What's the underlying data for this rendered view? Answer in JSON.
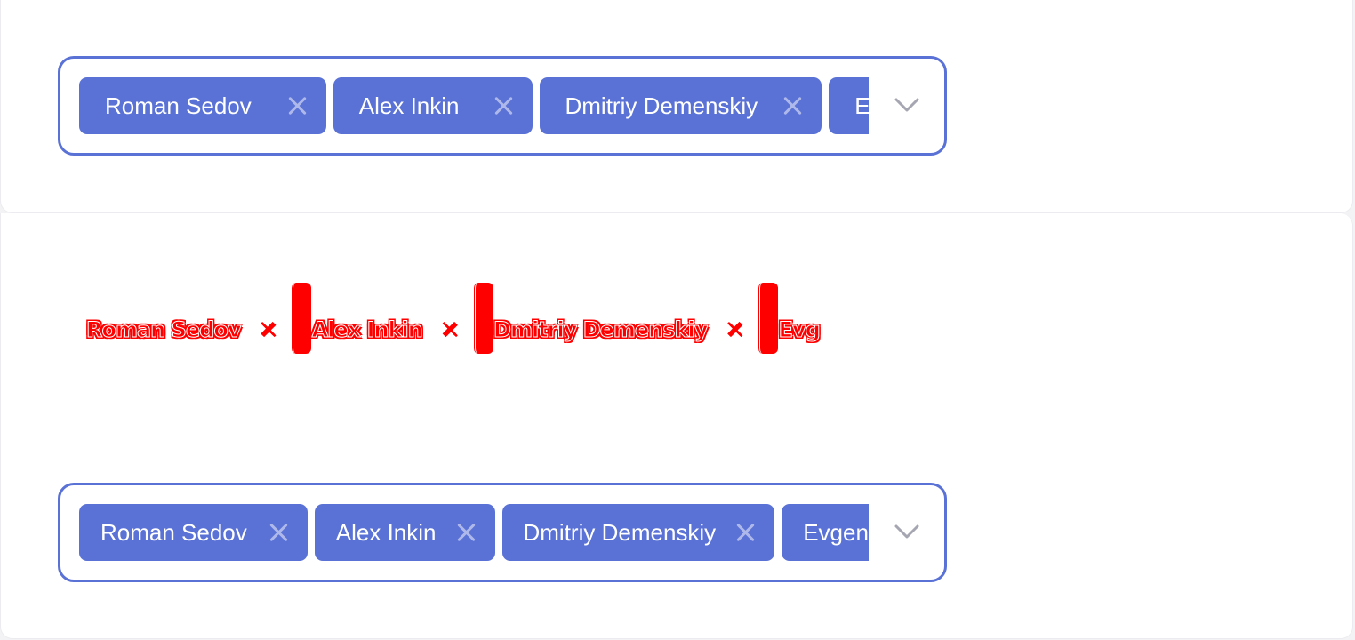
{
  "widgets": {
    "top": {
      "chips": [
        {
          "label": "Roman Sedov"
        },
        {
          "label": "Alex Inkin"
        },
        {
          "label": "Dmitriy Demenskiy"
        },
        {
          "label": "Evgeniy"
        }
      ]
    },
    "glitch": {
      "chips": [
        {
          "label": "Roman Sedov"
        },
        {
          "label": "Alex Inkin"
        },
        {
          "label": "Dmitriy Demenskiy"
        },
        {
          "label": "Evg"
        }
      ]
    },
    "bottom": {
      "chips": [
        {
          "label": "Roman Sedov"
        },
        {
          "label": "Alex Inkin"
        },
        {
          "label": "Dmitriy Demenskiy"
        },
        {
          "label": "Evgeniy"
        }
      ]
    }
  },
  "icons": {
    "chip_remove": "close-icon",
    "dropdown": "chevron-down-icon"
  },
  "colors": {
    "accent": "#5a72d6",
    "chip_text": "#ffffff",
    "remove_icon": "#aeb8ea",
    "chevron": "#a6a6b2",
    "glitch": "#ff0000"
  }
}
